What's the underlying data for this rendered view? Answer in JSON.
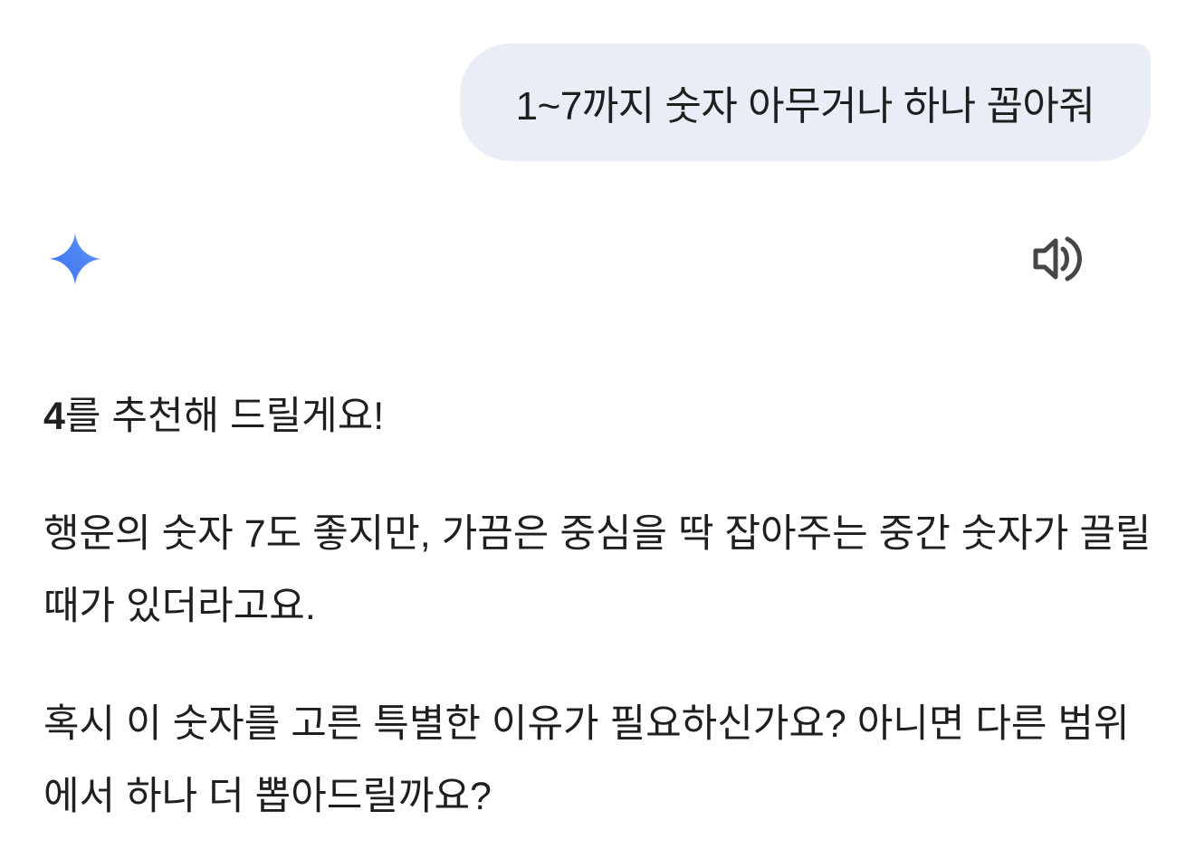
{
  "user_message": {
    "text": "1~7까지 숫자 아무거나 하나 꼽아줘"
  },
  "assistant": {
    "avatar_icon": "gemini-sparkle-icon",
    "avatar_colors": [
      "#4285f4",
      "#5b8cf0",
      "#7aa7ff"
    ],
    "read_aloud_icon": "speaker-icon",
    "response": {
      "p1_bold": "4",
      "p1_rest": "를 추천해 드릴게요!",
      "p2": "행운의 숫자 7도 좋지만, 가끔은 중심을 딱 잡아주는 중간 숫자가 끌릴 때가 있더라고요.",
      "p3": "혹시 이 숫자를 고른 특별한 이유가 필요하신가요? 아니면 다른 범위에서 하나 더 뽑아드릴까요?"
    }
  },
  "colors": {
    "user_bubble_bg": "#e9eef6",
    "text": "#1f1f1f",
    "icon_gray": "#444746"
  }
}
